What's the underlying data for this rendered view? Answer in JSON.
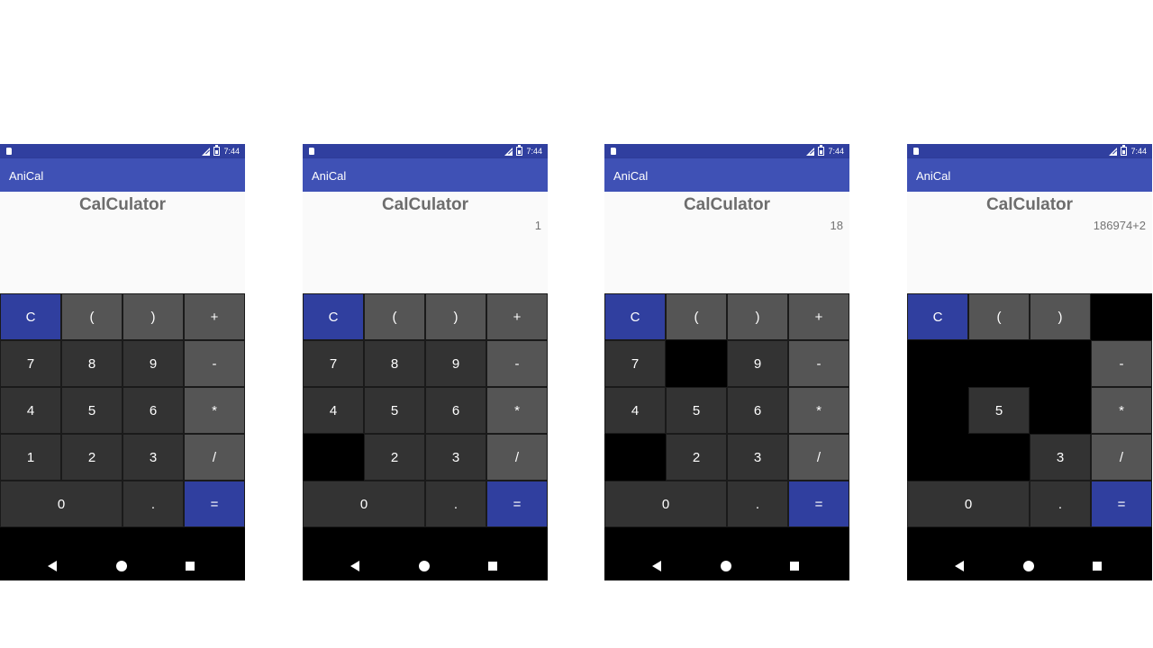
{
  "screens": [
    {
      "status_time": "7:44",
      "app_title": "AniCal",
      "display_title": "CalCulator",
      "expression": ""
    },
    {
      "status_time": "7:44",
      "app_title": "AniCal",
      "display_title": "CalCulator",
      "expression": "1"
    },
    {
      "status_time": "7:44",
      "app_title": "AniCal",
      "display_title": "CalCulator",
      "expression": "18"
    },
    {
      "status_time": "7:44",
      "app_title": "AniCal",
      "display_title": "CalCulator",
      "expression": "186974+2"
    }
  ],
  "keys": {
    "clear": "C",
    "open_paren": "(",
    "close_paren": ")",
    "plus": "+",
    "seven": "7",
    "eight": "8",
    "nine": "9",
    "minus": "-",
    "four": "4",
    "five": "5",
    "six": "6",
    "multiply": "*",
    "one": "1",
    "two": "2",
    "three": "3",
    "divide": "/",
    "zero": "0",
    "dot": ".",
    "equals": "="
  },
  "colors": {
    "status_bar": "#303f9f",
    "app_bar": "#3f51b5",
    "key_dark": "#333333",
    "key_operator": "#555555",
    "key_accent": "#303f9f",
    "key_pressed": "#000000"
  },
  "icons": {
    "sd_card": "sd-card-icon",
    "signal": "signal-icon",
    "battery": "battery-icon",
    "back": "back-icon",
    "home": "home-icon",
    "recents": "recents-icon"
  }
}
